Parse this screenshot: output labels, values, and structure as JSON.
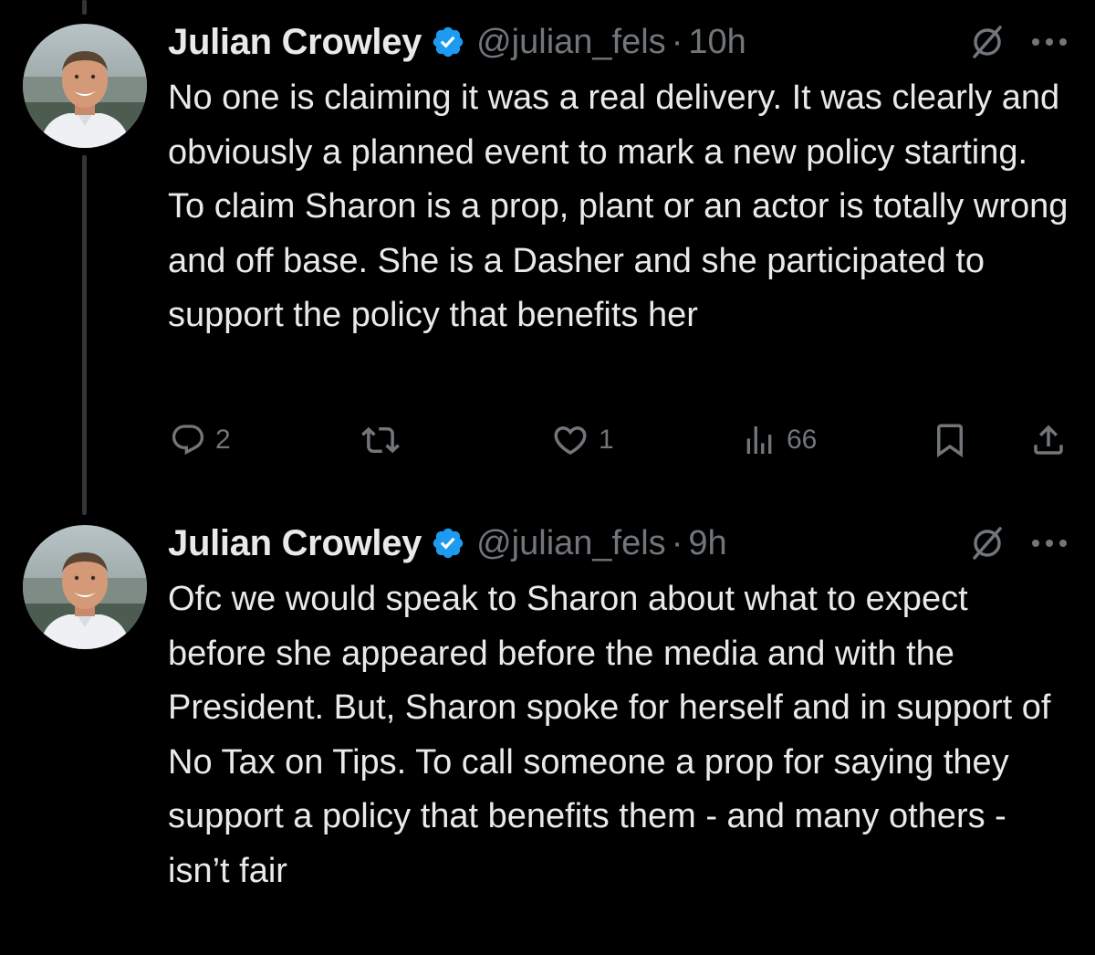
{
  "colors": {
    "background": "#000000",
    "text": "#e7e9ea",
    "secondary": "#71767b",
    "verified": "#1d9bf0",
    "thread_line": "#333639"
  },
  "tweets": [
    {
      "author_name": "Julian Crowley",
      "handle": "@julian_fels",
      "separator": "·",
      "time": "10h",
      "text": "No one is claiming it was a real delivery. It was clearly and obviously a planned event to mark a new policy starting. To claim Sharon is a prop, plant or an actor is totally wrong and off base. She is a Dasher and she participated to support the policy that benefits her",
      "replies": "2",
      "retweets": "",
      "likes": "1",
      "views": "66",
      "icons": [
        "verified-badge-icon",
        "grok-icon",
        "more-icon",
        "reply-icon",
        "retweet-icon",
        "like-icon",
        "views-icon",
        "bookmark-icon",
        "share-icon"
      ]
    },
    {
      "author_name": "Julian Crowley",
      "handle": "@julian_fels",
      "separator": "·",
      "time": "9h",
      "text": "Ofc we would speak to Sharon about what to expect before she appeared before the media and with the President. But, Sharon spoke for herself and in support of No Tax on Tips. To call someone a prop for saying they support a policy that benefits them - and many others - isn’t fair",
      "icons": [
        "verified-badge-icon",
        "grok-icon",
        "more-icon"
      ]
    }
  ]
}
